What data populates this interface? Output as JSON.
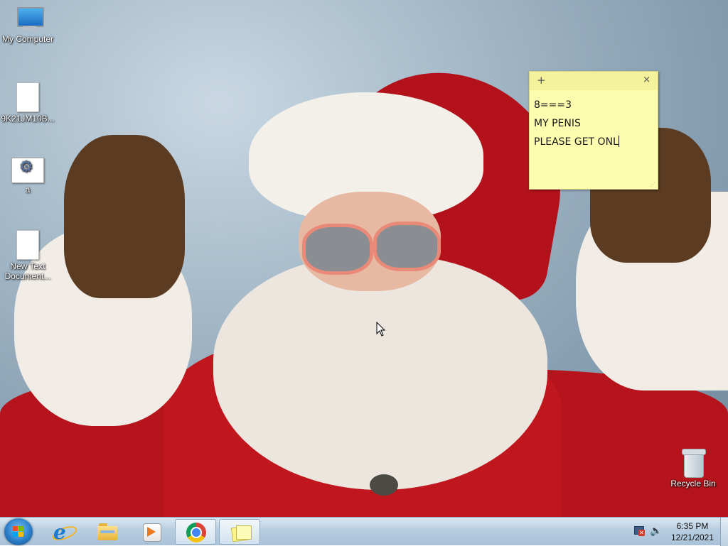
{
  "desktop": {
    "icons": [
      {
        "label": "My Computer",
        "kind": "computer-icon"
      },
      {
        "label": "9K21JM10B...",
        "kind": "document-icon"
      },
      {
        "label": "a",
        "kind": "settings-file-icon"
      },
      {
        "label": "New Text Document...",
        "kind": "text-document-icon"
      }
    ],
    "recycle_bin": {
      "label": "Recycle Bin",
      "kind": "recycle-bin-icon"
    }
  },
  "sticky_note": {
    "add_glyph": "+",
    "close_glyph": "×",
    "lines": [
      "8===3",
      "MY PENIS",
      "PLEASE GET ONL"
    ],
    "background_color": "#fdfdb0"
  },
  "taskbar": {
    "start": {
      "kind": "windows-start-icon"
    },
    "pinned": [
      {
        "kind": "internet-explorer-icon"
      },
      {
        "kind": "file-explorer-icon"
      },
      {
        "kind": "media-player-icon"
      },
      {
        "kind": "chrome-icon",
        "active": true
      },
      {
        "kind": "sticky-notes-icon",
        "active": true
      }
    ],
    "tray": {
      "network": "network-error-icon",
      "volume": "speaker-icon",
      "time": "6:35 PM",
      "date": "12/21/2021"
    }
  }
}
